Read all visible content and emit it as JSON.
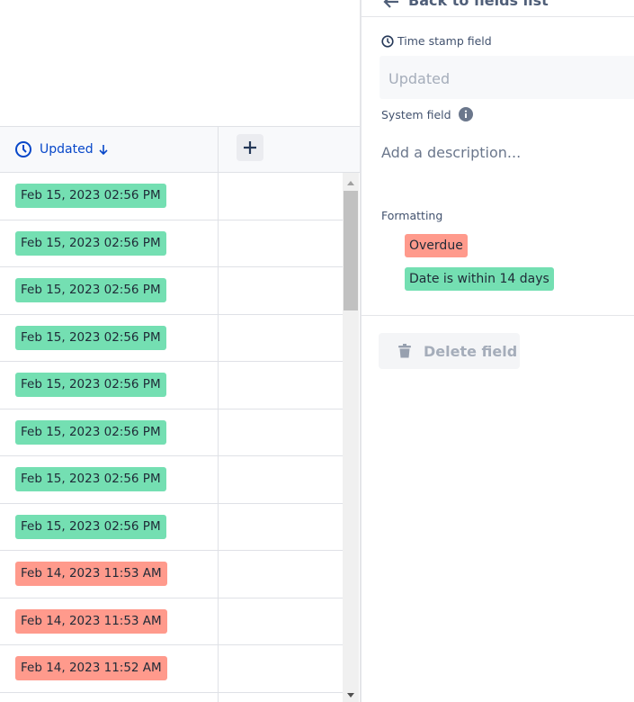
{
  "table": {
    "column_header": "Updated",
    "sort": "descending",
    "rows": [
      {
        "value": "Feb 15, 2023 02:56 PM",
        "status": "within14"
      },
      {
        "value": "Feb 15, 2023 02:56 PM",
        "status": "within14"
      },
      {
        "value": "Feb 15, 2023 02:56 PM",
        "status": "within14"
      },
      {
        "value": "Feb 15, 2023 02:56 PM",
        "status": "within14"
      },
      {
        "value": "Feb 15, 2023 02:56 PM",
        "status": "within14"
      },
      {
        "value": "Feb 15, 2023 02:56 PM",
        "status": "within14"
      },
      {
        "value": "Feb 15, 2023 02:56 PM",
        "status": "within14"
      },
      {
        "value": "Feb 15, 2023 02:56 PM",
        "status": "within14"
      },
      {
        "value": "Feb 14, 2023 11:53 AM",
        "status": "overdue"
      },
      {
        "value": "Feb 14, 2023 11:53 AM",
        "status": "overdue"
      },
      {
        "value": "Feb 14, 2023 11:52 AM",
        "status": "overdue"
      },
      {
        "value": "",
        "status": ""
      }
    ]
  },
  "colors": {
    "within14": "#74dfb2",
    "overdue": "#ff9a8c",
    "accent": "#0747c9"
  },
  "panel": {
    "back_label": "Back to fields list",
    "field_type": "Time stamp field",
    "field_name": "Updated",
    "system_label": "System field",
    "description_placeholder": "Add a description...",
    "formatting_label": "Formatting",
    "rules": [
      {
        "label": "Overdue",
        "status": "overdue"
      },
      {
        "label": "Date is within 14 days",
        "status": "within14"
      }
    ],
    "delete_label": "Delete field"
  }
}
